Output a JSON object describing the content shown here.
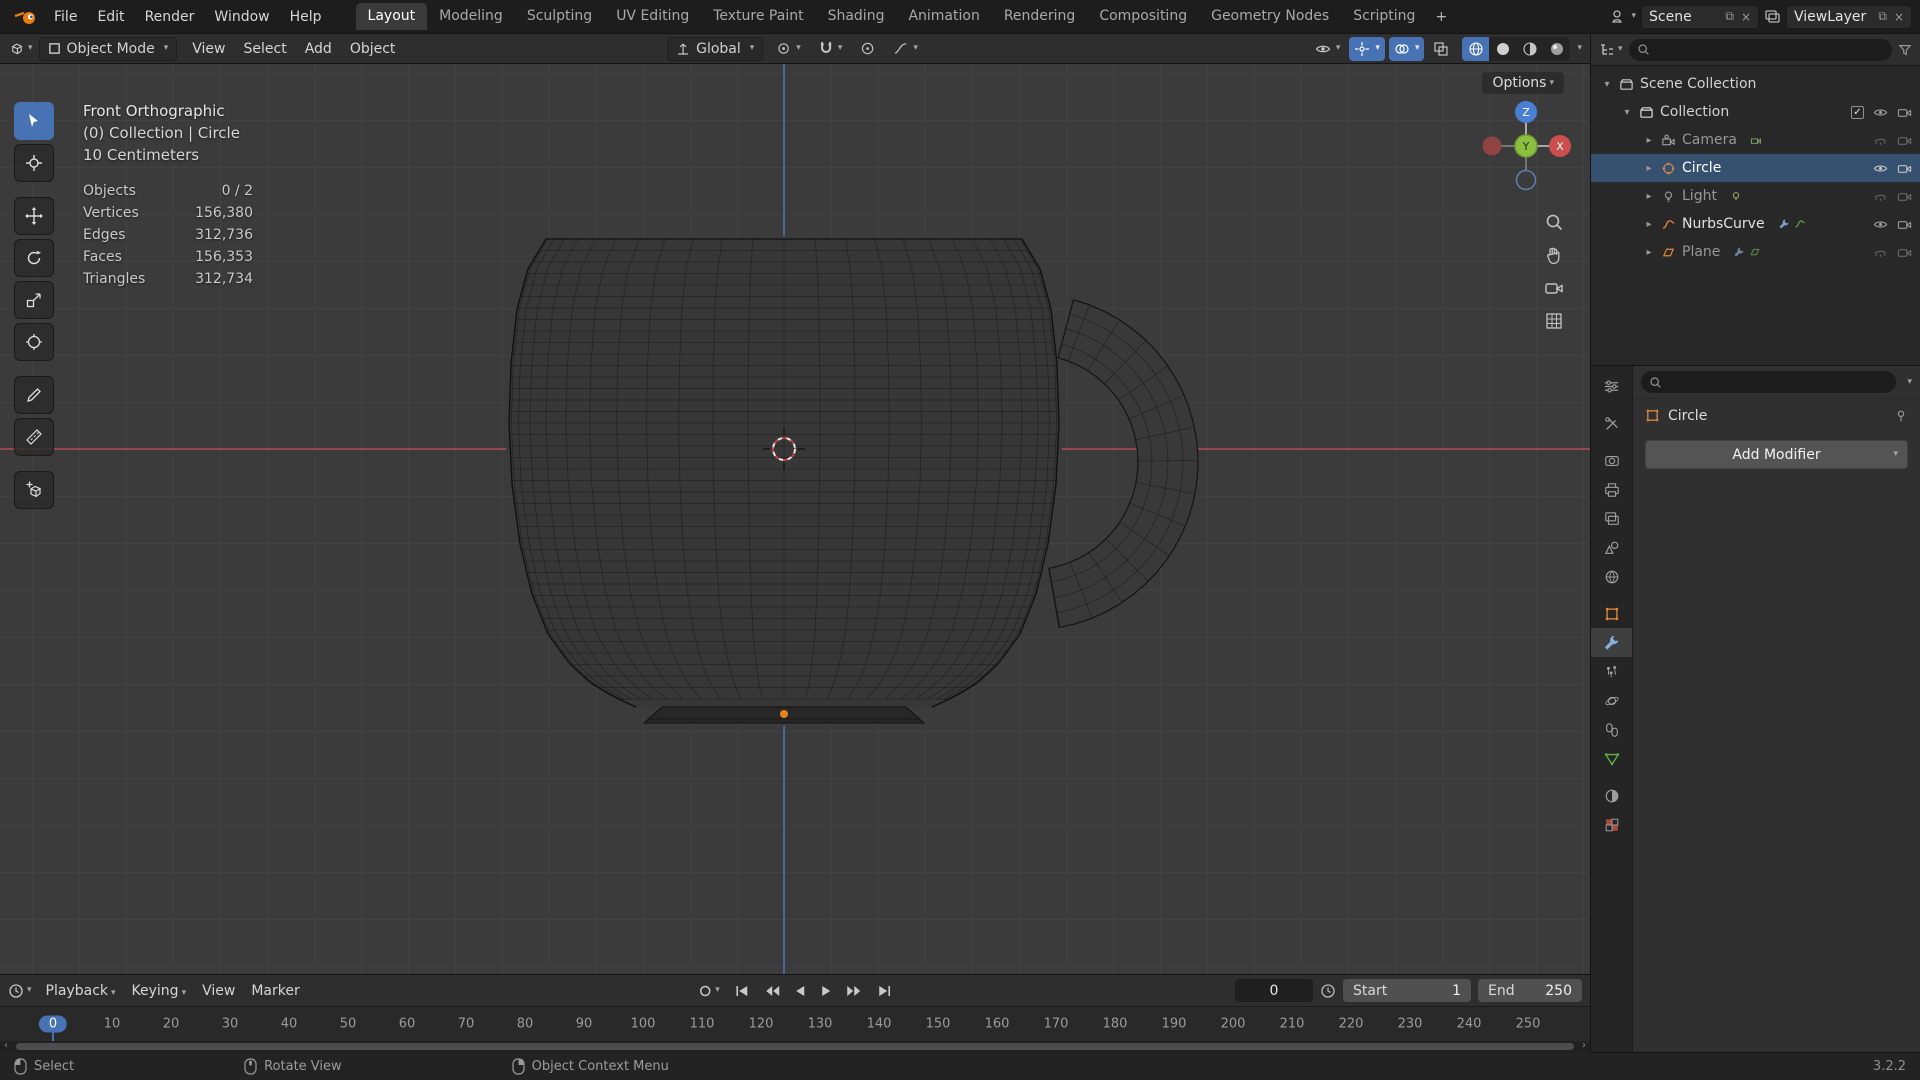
{
  "topbar": {
    "menus": [
      "File",
      "Edit",
      "Render",
      "Window",
      "Help"
    ],
    "workspaces": [
      "Layout",
      "Modeling",
      "Sculpting",
      "UV Editing",
      "Texture Paint",
      "Shading",
      "Animation",
      "Rendering",
      "Compositing",
      "Geometry Nodes",
      "Scripting"
    ],
    "add_tab": "+",
    "scene_field": "Scene",
    "view_layer_field": "ViewLayer"
  },
  "viewport_header": {
    "mode": "Object Mode",
    "menus": [
      "View",
      "Select",
      "Add",
      "Object"
    ],
    "orientation": "Global"
  },
  "viewport": {
    "options_label": "Options",
    "overlay": {
      "view_name": "Front Orthographic",
      "context": "(0) Collection | Circle",
      "grid_scale": "10 Centimeters",
      "stats": [
        {
          "label": "Objects",
          "value": "0 / 2"
        },
        {
          "label": "Vertices",
          "value": "156,380"
        },
        {
          "label": "Edges",
          "value": "312,736"
        },
        {
          "label": "Faces",
          "value": "156,353"
        },
        {
          "label": "Triangles",
          "value": "312,734"
        }
      ]
    },
    "axis_labels": {
      "x": "X",
      "y": "Y",
      "z": "Z"
    },
    "colors": {
      "axis_x": "#b34a55",
      "axis_z": "#4672b4",
      "accent": "#4772b3",
      "origin": "#e8821c"
    }
  },
  "outliner": {
    "scene_collection": "Scene Collection",
    "collection": "Collection",
    "items": [
      {
        "name": "Camera"
      },
      {
        "name": "Circle"
      },
      {
        "name": "Light"
      },
      {
        "name": "NurbsCurve"
      },
      {
        "name": "Plane"
      }
    ]
  },
  "properties": {
    "active_object": "Circle",
    "add_modifier_label": "Add Modifier"
  },
  "timeline": {
    "menus": [
      "Playback",
      "Keying",
      "View",
      "Marker"
    ],
    "current_frame": "0",
    "start_label": "Start",
    "start_value": "1",
    "end_label": "End",
    "end_value": "250",
    "ticks": [
      10,
      20,
      30,
      40,
      50,
      60,
      70,
      80,
      90,
      100,
      110,
      120,
      130,
      140,
      150,
      160,
      170,
      180,
      190,
      200,
      210,
      220,
      230,
      240,
      250
    ]
  },
  "statusbar": {
    "hints": [
      {
        "label": "Select"
      },
      {
        "label": "Rotate View"
      },
      {
        "label": "Object Context Menu"
      }
    ],
    "version": "3.2.2"
  }
}
